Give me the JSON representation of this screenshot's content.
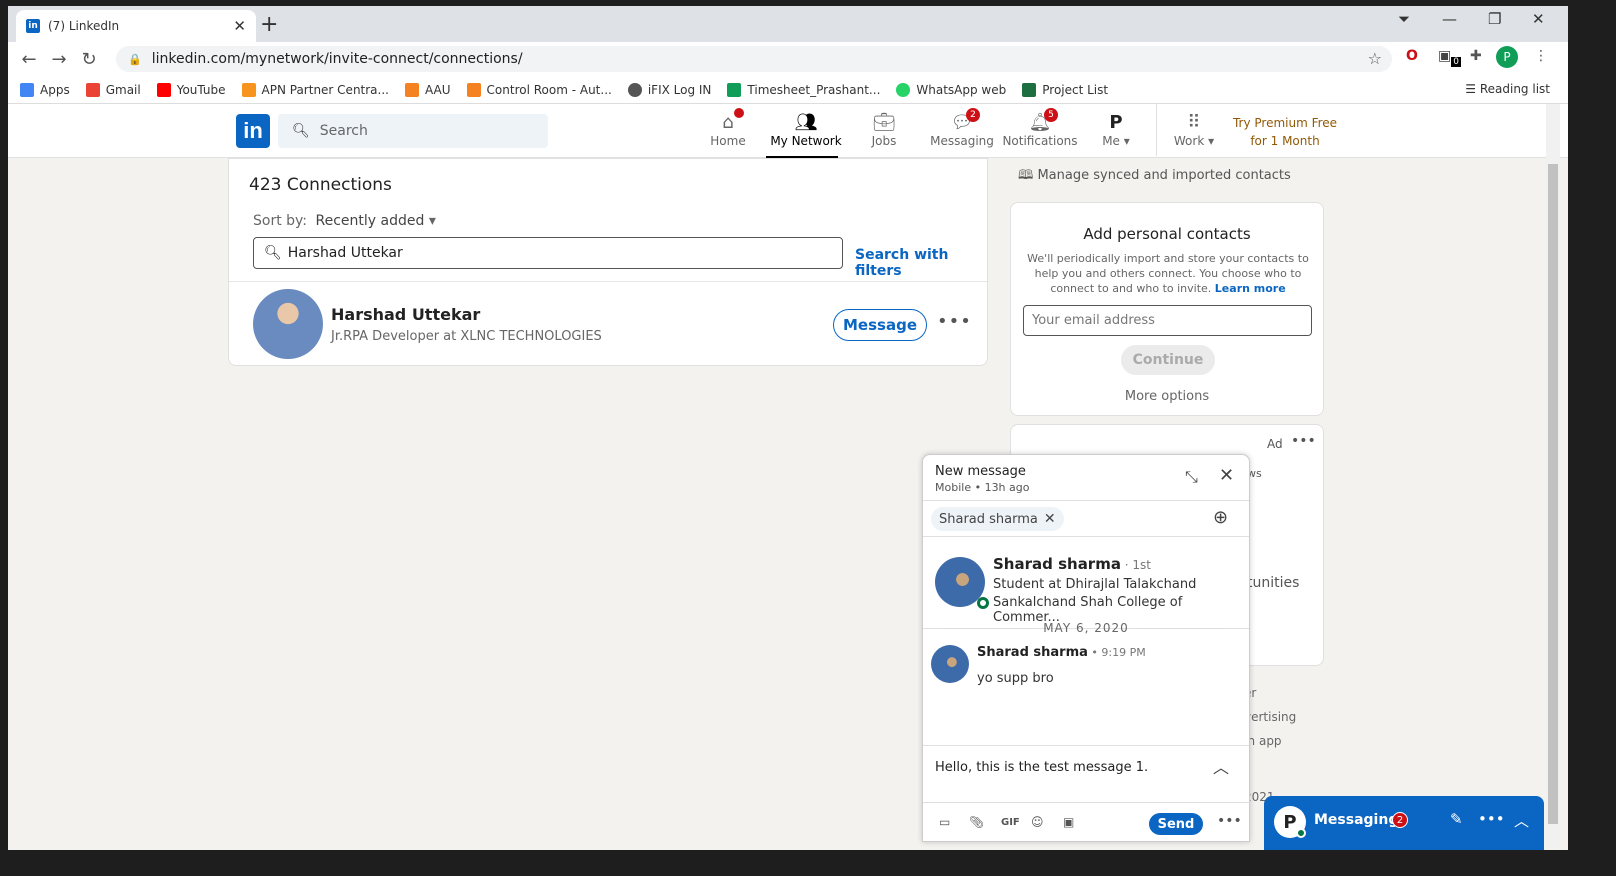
{
  "browser": {
    "tab_title": "(7) LinkedIn",
    "tab_favicon": "in",
    "url": "linkedin.com/mynetwork/invite-connect/connections/",
    "extension_badge": "0",
    "profile_initial": "P",
    "bookmarks": [
      {
        "label": "Apps",
        "color": "#4285f4"
      },
      {
        "label": "Gmail",
        "color": "#ea4335"
      },
      {
        "label": "YouTube",
        "color": "#ff0000"
      },
      {
        "label": "APN Partner Centra...",
        "color": "#f7941d"
      },
      {
        "label": "AAU",
        "color": "#f58220"
      },
      {
        "label": "Control Room - Aut...",
        "color": "#f58220"
      },
      {
        "label": "iFIX Log IN",
        "color": "#555555"
      },
      {
        "label": "Timesheet_Prashant...",
        "color": "#0f9d58"
      },
      {
        "label": "WhatsApp web",
        "color": "#25d366"
      },
      {
        "label": "Project List",
        "color": "#1d6f42"
      }
    ],
    "reading_list": "Reading list"
  },
  "linkedin_header": {
    "logo": "in",
    "search_placeholder": "Search",
    "nav": [
      {
        "label": "Home",
        "icon": "home-icon",
        "badge": ""
      },
      {
        "label": "My Network",
        "icon": "network-icon",
        "badge": ""
      },
      {
        "label": "Jobs",
        "icon": "briefcase-icon",
        "badge": ""
      },
      {
        "label": "Messaging",
        "icon": "chat-icon",
        "badge": "2"
      },
      {
        "label": "Notifications",
        "icon": "bell-icon",
        "badge": "5"
      },
      {
        "label": "Me",
        "icon": "avatar-icon",
        "badge": ""
      },
      {
        "label": "Work",
        "icon": "grid-icon",
        "badge": ""
      }
    ],
    "premium_line1": "Try Premium Free",
    "premium_line2": "for 1 Month"
  },
  "connections": {
    "count_label": "423 Connections",
    "sort_label": "Sort by:",
    "sort_value": "Recently added",
    "filter_value": "Harshad Uttekar",
    "search_with_filters": "Search with filters",
    "person": {
      "name": "Harshad Uttekar",
      "title": "Jr.RPA Developer at XLNC TECHNOLOGIES",
      "message_label": "Message"
    }
  },
  "sidebar": {
    "manage_label": "Manage synced and imported contacts",
    "add_contacts_title": "Add personal contacts",
    "add_contacts_desc": "We'll periodically import and store your contacts to help you and others connect. You choose who to connect to and who to invite.",
    "learn_more": "Learn more",
    "email_placeholder": "Your email address",
    "continue_label": "Continue",
    "more_options": "More options",
    "ad_label": "Ad",
    "ad_fragments": [
      "ws",
      "tunities"
    ],
    "footer_fragments": [
      "er",
      "vertising",
      "In app",
      "2021"
    ]
  },
  "new_message": {
    "title": "New message",
    "subtitle": "Mobile  •  13h ago",
    "recipient": "Sharad sharma",
    "profile": {
      "name": "Sharad sharma",
      "degree": " · 1st",
      "line1": "Student at Dhirajlal Talakchand",
      "line2": "Sankalchand Shah College of Commer..."
    },
    "date_separator": "MAY 6, 2020",
    "message": {
      "sender": "Sharad sharma",
      "time": " • 9:19 PM",
      "text": "yo supp bro"
    },
    "draft": "Hello, this is the test message 1.",
    "send_label": "Send",
    "toolbar_icons": [
      "image-icon",
      "attach-icon",
      "gif-icon",
      "emoji-icon",
      "video-icon"
    ],
    "gif_label": "GIF"
  },
  "messaging_bar": {
    "title": "Messaging",
    "badge": "2",
    "avatar": "P"
  }
}
